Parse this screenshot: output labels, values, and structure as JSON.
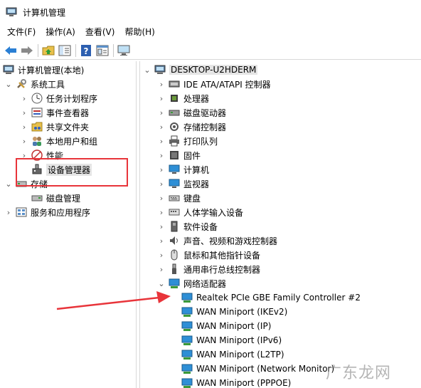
{
  "window": {
    "title": "计算机管理"
  },
  "menu": [
    "文件(F)",
    "操作(A)",
    "查看(V)",
    "帮助(H)"
  ],
  "toolbar_icons": [
    "back-arrow-icon",
    "forward-arrow-icon",
    "folder-up-icon",
    "show-hide-tree-icon",
    "help-icon",
    "properties-icon",
    "monitor-scan-icon"
  ],
  "left_tree": {
    "root": "计算机管理(本地)",
    "system_tools": "系统工具",
    "items": [
      "任务计划程序",
      "事件查看器",
      "共享文件夹",
      "本地用户和组",
      "性能",
      "设备管理器"
    ],
    "storage": "存储",
    "disk_mgmt": "磁盘管理",
    "services": "服务和应用程序"
  },
  "right_tree": {
    "computer": "DESKTOP-U2HDERM",
    "categories": [
      "IDE ATA/ATAPI 控制器",
      "处理器",
      "磁盘驱动器",
      "存储控制器",
      "打印队列",
      "固件",
      "计算机",
      "监视器",
      "键盘",
      "人体学输入设备",
      "软件设备",
      "声音、视频和游戏控制器",
      "鼠标和其他指针设备",
      "通用串行总线控制器"
    ],
    "network_adapters": "网络适配器",
    "adapters": [
      "Realtek PCIe GBE Family Controller #2",
      "WAN Miniport (IKEv2)",
      "WAN Miniport (IP)",
      "WAN Miniport (IPv6)",
      "WAN Miniport (L2TP)",
      "WAN Miniport (Network Monitor)",
      "WAN Miniport (PPPOE)"
    ]
  },
  "watermark": "广东龙网",
  "colors": {
    "highlight_red": "#e8343a",
    "selected_bg": "#e5e5e5",
    "network_icon": "#2e8fd6"
  }
}
